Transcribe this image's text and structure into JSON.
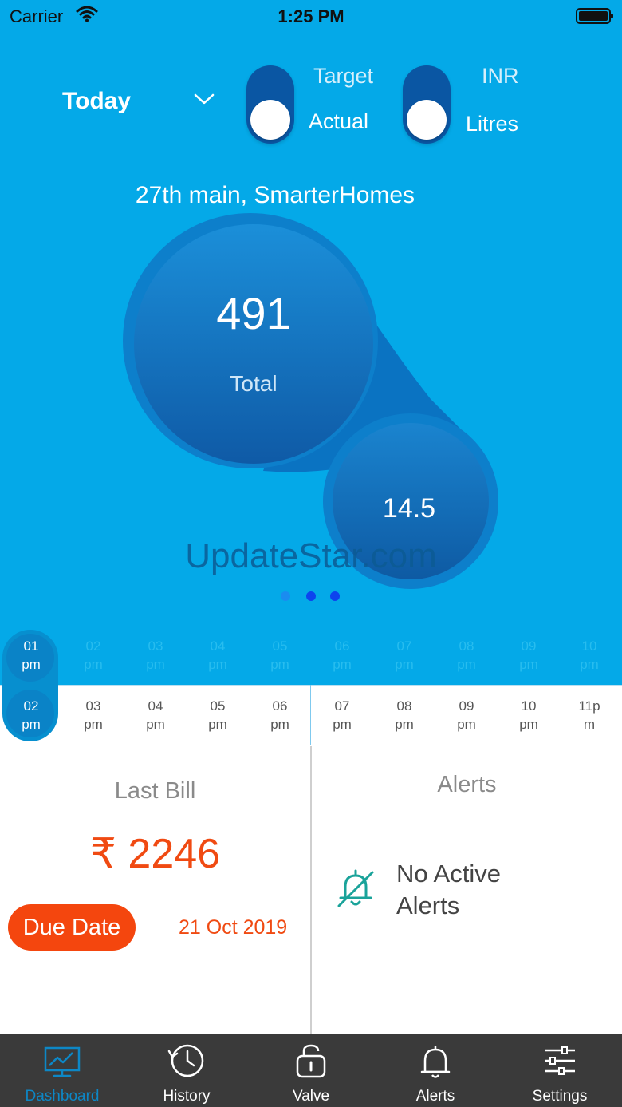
{
  "status_bar": {
    "carrier": "Carrier",
    "time": "1:25 PM"
  },
  "header": {
    "period": "Today",
    "toggle1": {
      "top_label": "Target",
      "bottom_label": "Actual"
    },
    "toggle2": {
      "top_label": "INR",
      "bottom_label": "Litres"
    }
  },
  "location": "27th main,  SmarterHomes",
  "gauge": {
    "total_value": "491",
    "total_label": "Total",
    "secondary_value": "14.5"
  },
  "watermark": "UpdateStar.com",
  "page_indicator": {
    "count": 3,
    "active_index": 0
  },
  "timeline": {
    "top_row": [
      {
        "h": "01",
        "p": "pm"
      },
      {
        "h": "02",
        "p": "pm"
      },
      {
        "h": "03",
        "p": "pm"
      },
      {
        "h": "04",
        "p": "pm"
      },
      {
        "h": "05",
        "p": "pm"
      },
      {
        "h": "06",
        "p": "pm"
      },
      {
        "h": "07",
        "p": "pm"
      },
      {
        "h": "08",
        "p": "pm"
      },
      {
        "h": "09",
        "p": "pm"
      },
      {
        "h": "10",
        "p": "pm"
      }
    ],
    "bottom_row": [
      {
        "h": "02",
        "p": "pm"
      },
      {
        "h": "03",
        "p": "pm"
      },
      {
        "h": "04",
        "p": "pm"
      },
      {
        "h": "05",
        "p": "pm"
      },
      {
        "h": "06",
        "p": "pm"
      },
      {
        "h": "07",
        "p": "pm"
      },
      {
        "h": "08",
        "p": "pm"
      },
      {
        "h": "09",
        "p": "pm"
      },
      {
        "h": "10",
        "p": "pm"
      },
      {
        "h": "11p",
        "p": "m"
      }
    ]
  },
  "bill": {
    "title": "Last Bill",
    "amount": "₹ 2246",
    "due_label": "Due Date",
    "due_date": "21 Oct 2019"
  },
  "alerts": {
    "title": "Alerts",
    "message": "No Active Alerts"
  },
  "tabbar": {
    "items": [
      {
        "label": "Dashboard",
        "icon": "dashboard-icon"
      },
      {
        "label": "History",
        "icon": "history-icon"
      },
      {
        "label": "Valve",
        "icon": "valve-icon"
      },
      {
        "label": "Alerts",
        "icon": "bell-icon"
      },
      {
        "label": "Settings",
        "icon": "settings-sliders-icon"
      }
    ],
    "active_index": 0
  },
  "colors": {
    "hero_bg": "#04a9e8",
    "accent_orange": "#f04a12",
    "tab_active": "#0d87c6",
    "tabbar_bg": "#3a3a3a"
  }
}
